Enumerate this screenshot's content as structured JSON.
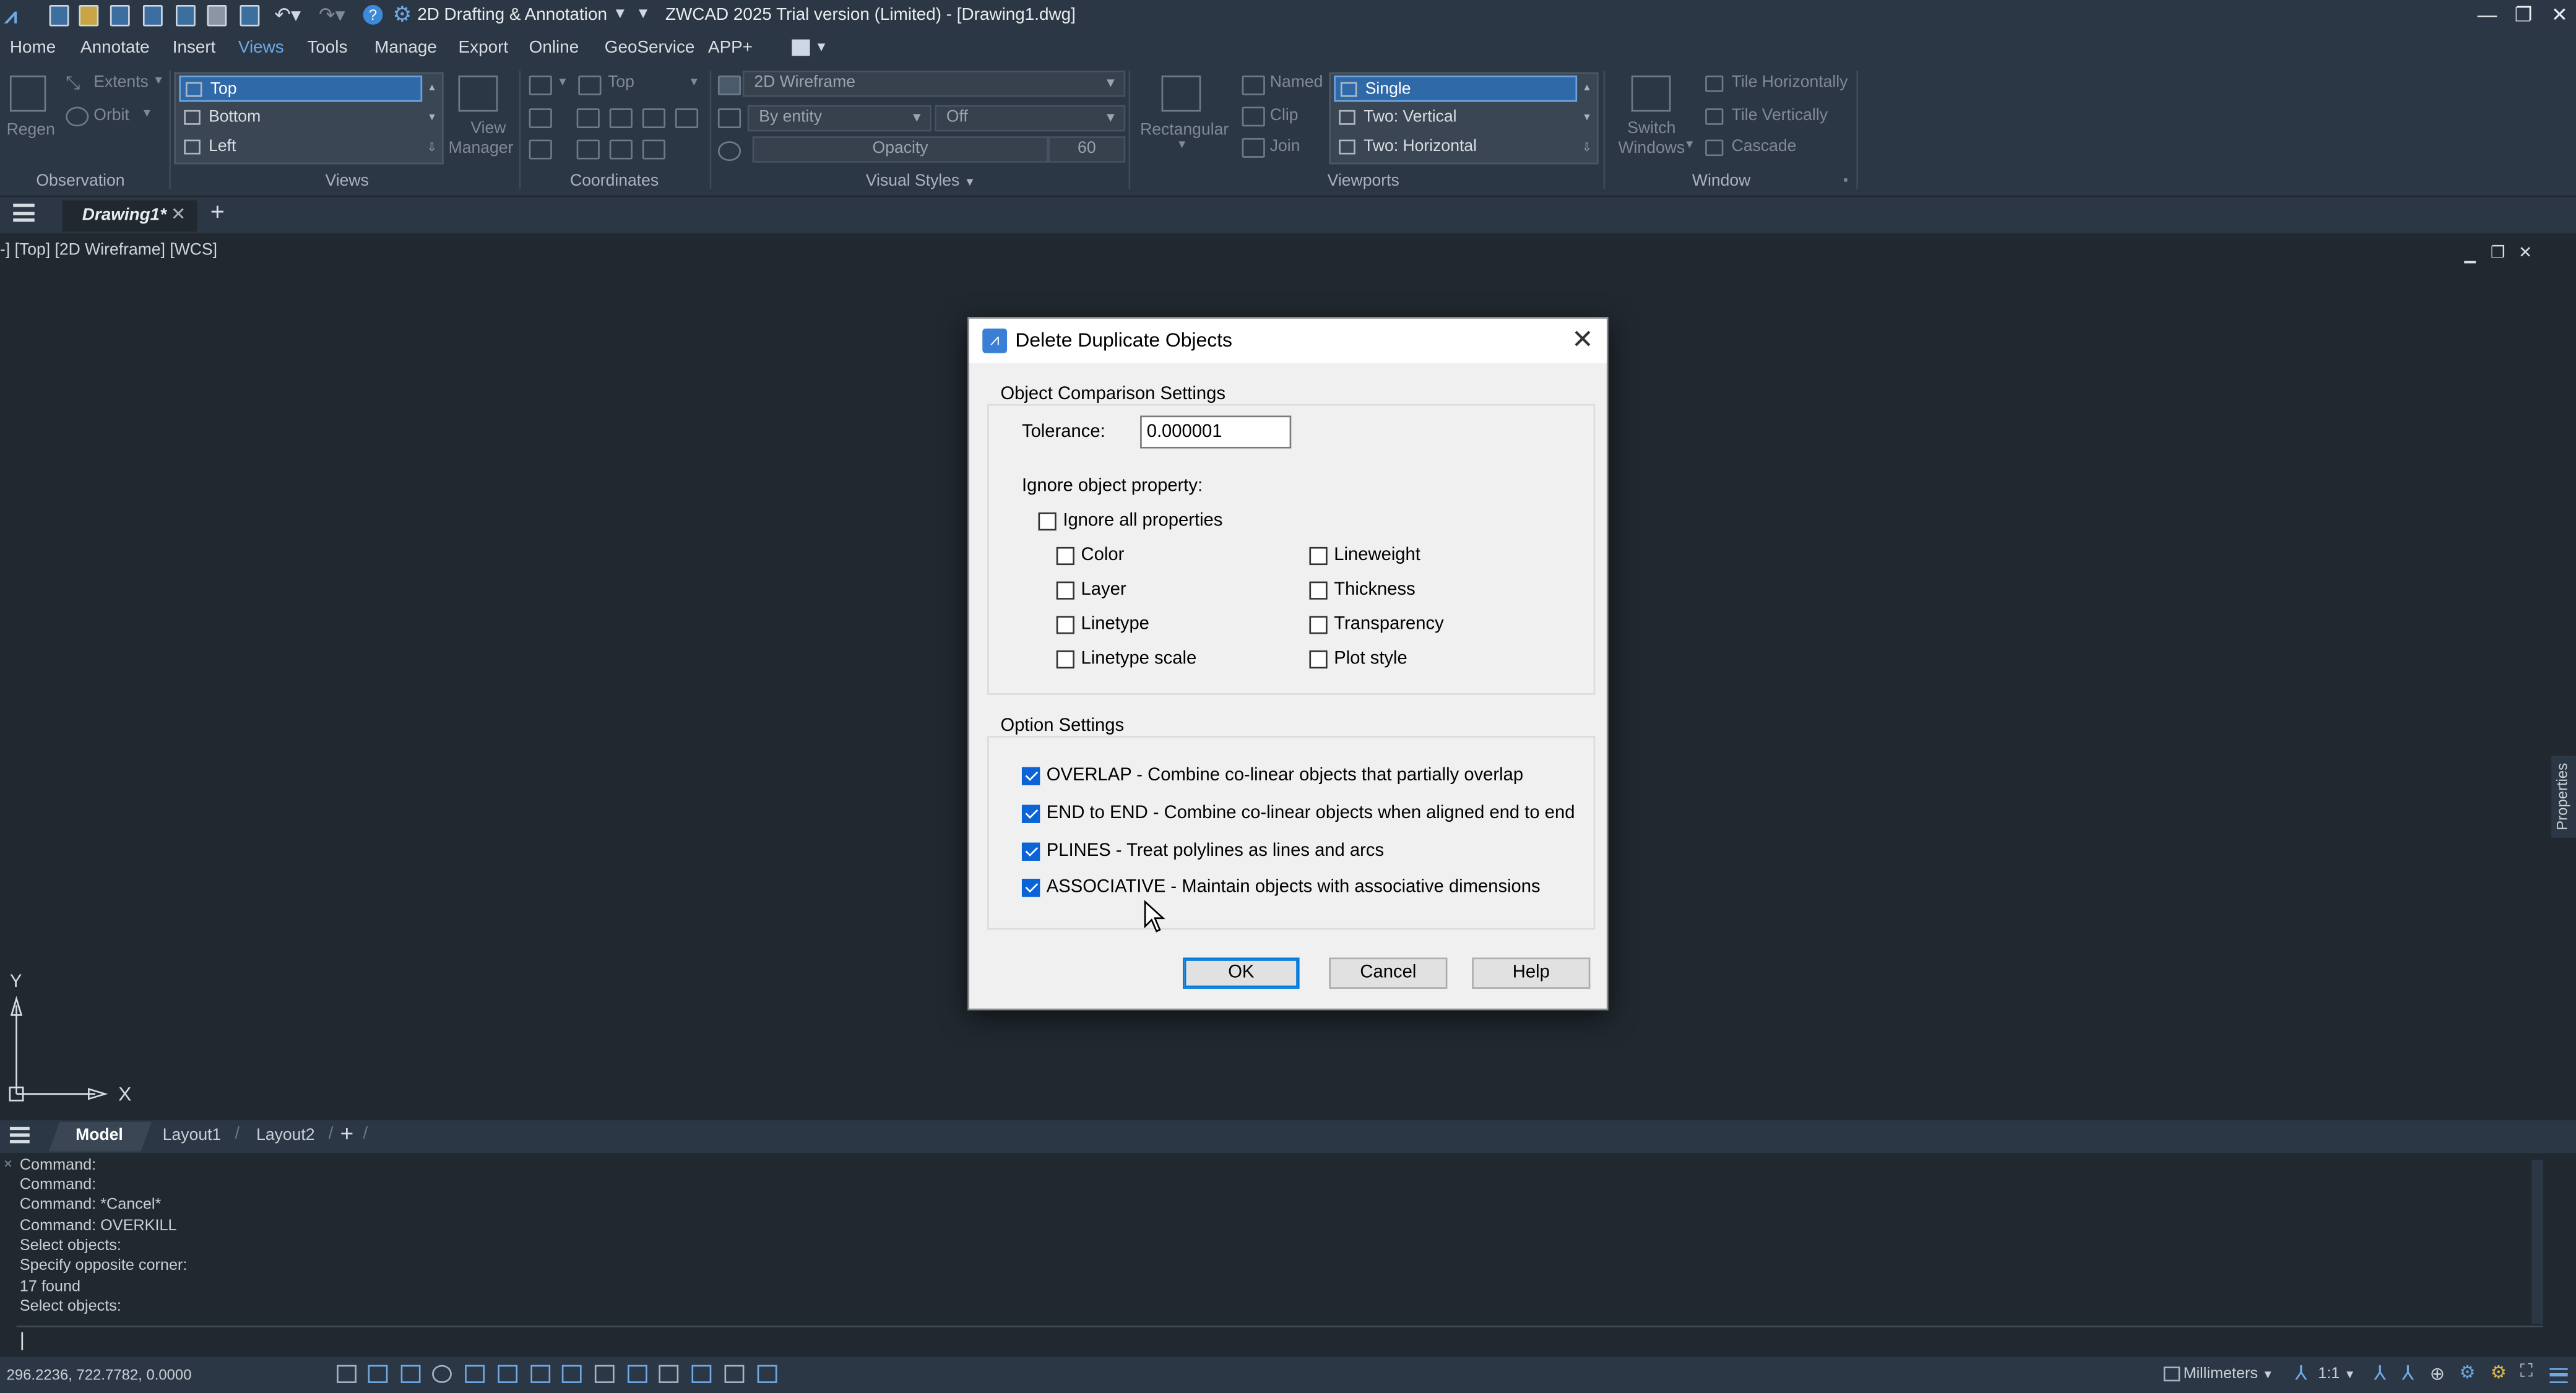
{
  "title_bar": {
    "workspace": "2D Drafting & Annotation",
    "app_title": "ZWCAD 2025 Trial version (Limited) - [Drawing1.dwg]"
  },
  "menu": [
    "Home",
    "Annotate",
    "Insert",
    "Views",
    "Tools",
    "Manage",
    "Export",
    "Online",
    "GeoService",
    "APP+"
  ],
  "menu_active": "Views",
  "ribbon": {
    "observation": {
      "regen": "Regen",
      "extents": "Extents",
      "orbit": "Orbit",
      "title": "Observation"
    },
    "views": {
      "items": [
        "Top",
        "Bottom",
        "Left"
      ],
      "selected": "Top",
      "view_manager_1": "View",
      "view_manager_2": "Manager",
      "title": "Views"
    },
    "coordinates": {
      "combo": "Top",
      "title": "Coordinates"
    },
    "visual_styles": {
      "style": "2D Wireframe",
      "entity": "By entity",
      "off": "Off",
      "opacity_label": "Opacity",
      "opacity_value": "60",
      "title": "Visual Styles"
    },
    "viewports": {
      "rectangular": "Rectangular",
      "named": "Named",
      "clip": "Clip",
      "join": "Join",
      "items": [
        "Single",
        "Two:  Vertical",
        "Two:  Horizontal"
      ],
      "selected": "Single",
      "title": "Viewports"
    },
    "window": {
      "switch_1": "Switch",
      "switch_2": "Windows",
      "tile_h": "Tile Horizontally",
      "tile_v": "Tile Vertically",
      "cascade": "Cascade",
      "title": "Window"
    }
  },
  "doc_tab": "Drawing1*",
  "viewport_label": "-] [Top] [2D Wireframe] [WCS]",
  "axis": {
    "x": "X",
    "y": "Y"
  },
  "dialog": {
    "title": "Delete Duplicate Objects",
    "comparison_title": "Object Comparison Settings",
    "tolerance_label": "Tolerance:",
    "tolerance_value": "0.000001",
    "ignore_label": "Ignore object property:",
    "ignore_all": "Ignore all properties",
    "props_left": [
      "Color",
      "Layer",
      "Linetype",
      "Linetype scale"
    ],
    "props_right": [
      "Lineweight",
      "Thickness",
      "Transparency",
      "Plot style"
    ],
    "option_title": "Option Settings",
    "options": [
      "OVERLAP - Combine co-linear objects that partially overlap",
      "END to END - Combine co-linear objects when aligned end to end",
      "PLINES -  Treat polylines as lines and arcs",
      "ASSOCIATIVE - Maintain objects with associative dimensions"
    ],
    "ok": "OK",
    "cancel": "Cancel",
    "help": "Help"
  },
  "layout_tabs": [
    "Model",
    "Layout1",
    "Layout2"
  ],
  "command_history": [
    "Command:",
    "Command:",
    "Command: *Cancel*",
    "Command: OVERKILL",
    "Select objects:",
    "Specify opposite corner:",
    "17 found",
    "Select objects:"
  ],
  "status": {
    "coords": "296.2236, 722.7782, 0.0000",
    "units": "Millimeters",
    "scale": "1:1"
  },
  "side_panel": "Properties"
}
